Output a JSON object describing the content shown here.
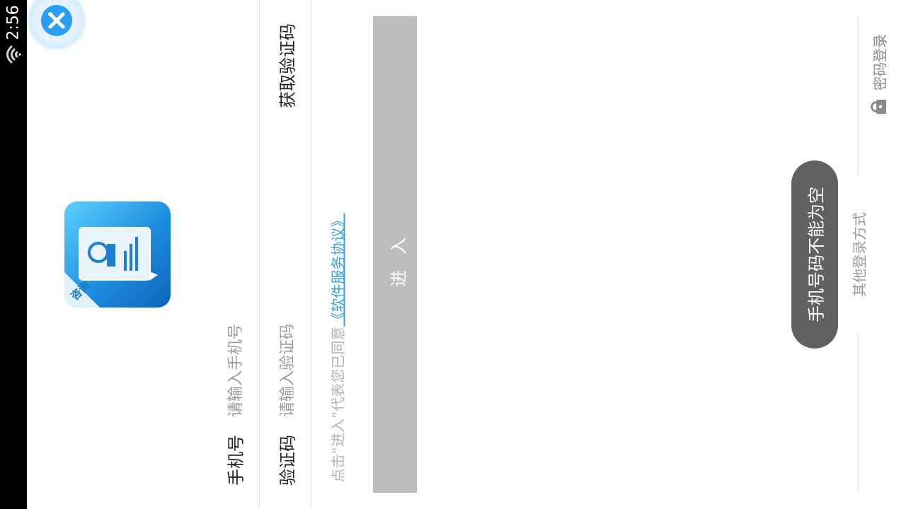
{
  "status_bar": {
    "time": "2:56",
    "wifi_icon": "wifi-icon"
  },
  "float_button": {
    "icon": "floating-assistant-close-icon"
  },
  "app_logo": {
    "icon": "app-logo-icon",
    "badge_text": "咨询"
  },
  "form": {
    "phone": {
      "label": "手机号",
      "placeholder": "请输入手机号"
    },
    "code": {
      "label": "验证码",
      "placeholder": "请输入验证码",
      "get_code": "获取验证码"
    }
  },
  "agreement": {
    "prefix": "点击“进入”代表您已同意",
    "link": "《软件服务协议》"
  },
  "enter_button": {
    "label": "进入"
  },
  "toast": {
    "text": "手机号码不能为空"
  },
  "other_login": {
    "label": "其他登录方式",
    "password_login": "密码登录",
    "lock_icon": "lock-icon"
  },
  "colors": {
    "accent": "#3aa0e0",
    "button_disabled": "#bdbdbd",
    "toast_bg": "#616161"
  }
}
